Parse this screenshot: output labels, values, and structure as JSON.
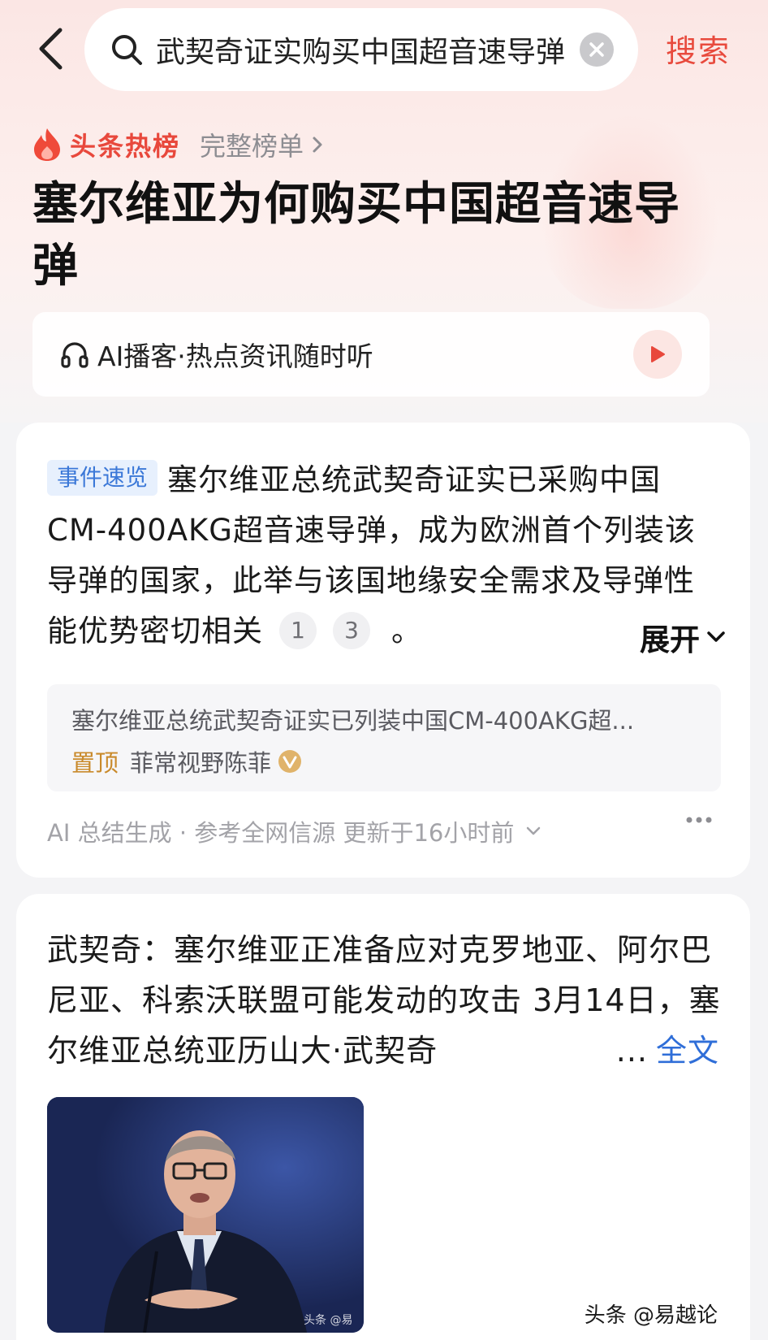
{
  "search": {
    "query": "武契奇证实购买中国超音速导弹",
    "action_label": "搜索"
  },
  "hotlist": {
    "title": "头条热榜",
    "full_list_label": "完整榜单"
  },
  "topic_title": "塞尔维亚为何购买中国超音速导弹",
  "podcast": {
    "label": "AI播客·热点资讯随时听"
  },
  "summary": {
    "tag": "事件速览",
    "text": "塞尔维亚总统武契奇证实已采购中国CM-400AKG超音速导弹，成为欧洲首个列装该导弹的国家，此举与该国地缘安全需求及导弹性能优势密切相关",
    "refs": [
      "1",
      "3"
    ],
    "period": "。",
    "expand_label": "展开",
    "source": {
      "title": "塞尔维亚总统武契奇证实已列装中国CM-400AKG超...",
      "pin_label": "置顶",
      "author": "菲常视野陈菲"
    },
    "footer": "AI 总结生成 · 参考全网信源 更新于16小时前"
  },
  "article": {
    "text": "武契奇：塞尔维亚正准备应对克罗地亚、阿尔巴尼亚、科索沃联盟可能发动的攻击 3月14日，塞尔维亚总统亚历山大·武契奇",
    "ellipsis": "...",
    "full_text_label": "全文",
    "image_watermark": "头条 @易"
  },
  "page_watermark": "头条 @易越论",
  "colors": {
    "accent_red": "#e84a3d",
    "link_blue": "#2f6ed8",
    "tag_blue": "#3b78d8",
    "pin_gold": "#c98a2b"
  }
}
